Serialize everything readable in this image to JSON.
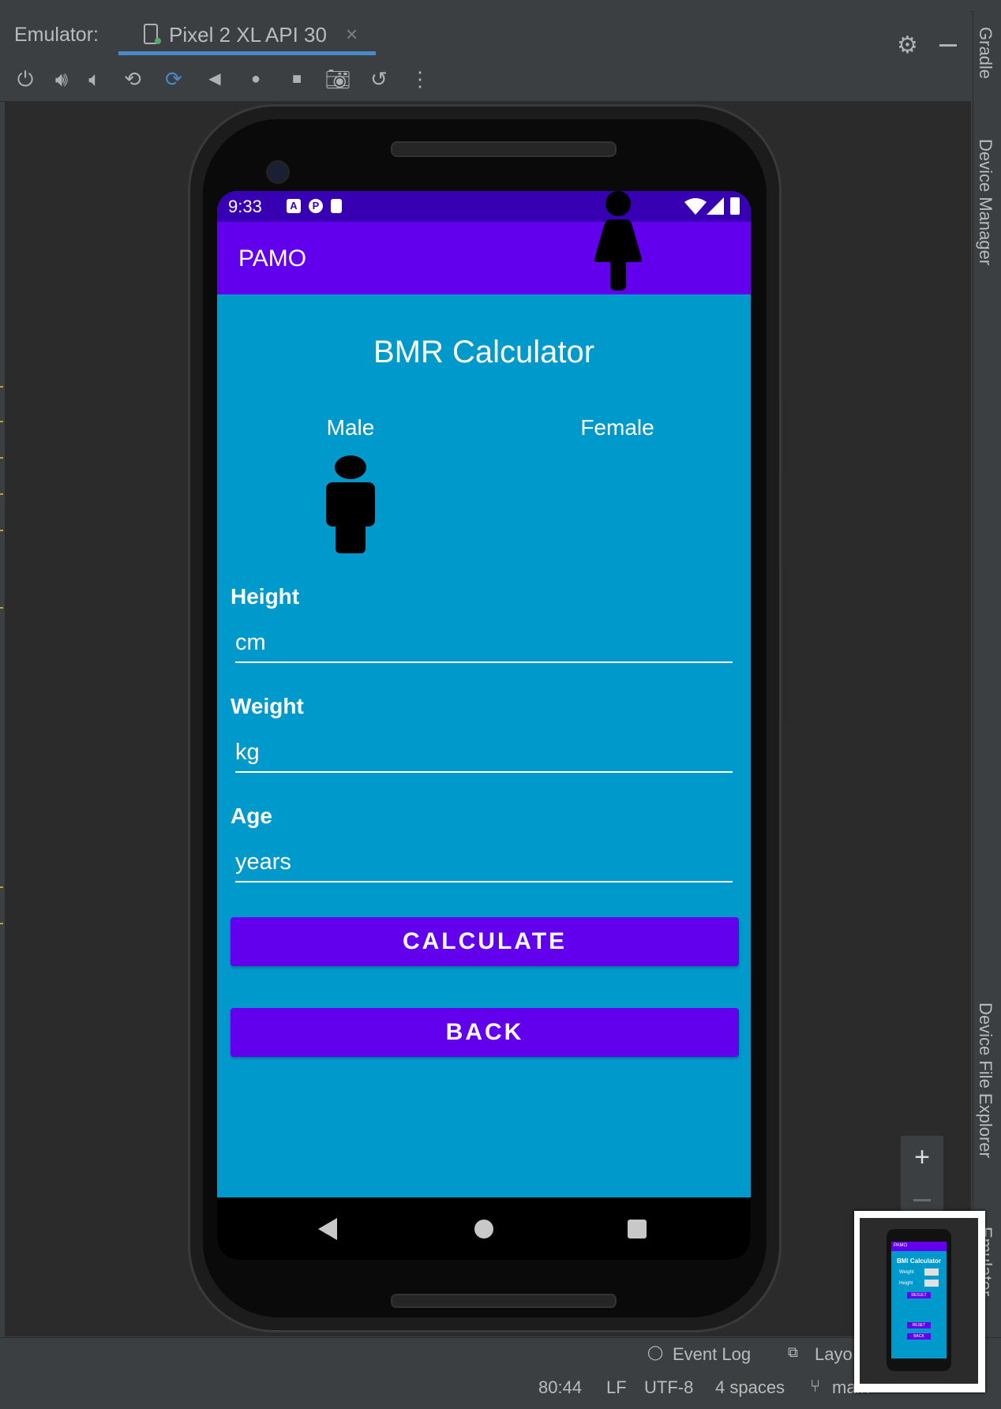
{
  "ide": {
    "tool_window_label": "Emulator:",
    "device_tab": "Pixel 2 XL API 30",
    "tab_close": "×",
    "right_tabs": [
      "Gradle",
      "Device Manager",
      "Device File Explorer",
      "Emulator"
    ],
    "status_bar": {
      "event_log": "Event Log",
      "layout": "Layo",
      "cursor": "80:44",
      "line_ending": "LF",
      "encoding": "UTF-8",
      "indent": "4 spaces",
      "branch": "main"
    },
    "toolbar_icons": [
      "power-icon",
      "volume-up-icon",
      "volume-down-icon",
      "rotate-left-icon",
      "rotate-right-icon",
      "back-icon",
      "home-icon",
      "overview-icon",
      "screenshot-icon",
      "snapshot-icon",
      "more-icon"
    ],
    "zoom_in": "+"
  },
  "phone": {
    "status_time": "9:33",
    "app_title": "PAMO",
    "screen_title": "BMR Calculator",
    "gender": {
      "male_label": "Male",
      "female_label": "Female"
    },
    "fields": {
      "height_label": "Height",
      "height_placeholder": "cm",
      "weight_label": "Weight",
      "weight_placeholder": "kg",
      "age_label": "Age",
      "age_placeholder": "years"
    },
    "buttons": {
      "calculate": "CALCULATE",
      "back": "BACK"
    },
    "colors": {
      "status_bar": "#3700b3",
      "app_bar": "#6200ee",
      "background": "#0099cc",
      "button": "#6200ee"
    }
  },
  "minimap": {
    "app_title": "PAMO",
    "screen_title": "BMI Calculator",
    "weight": "Weight",
    "height": "Height",
    "result": "RESULT",
    "reset": "RESET",
    "back": "BACK"
  }
}
